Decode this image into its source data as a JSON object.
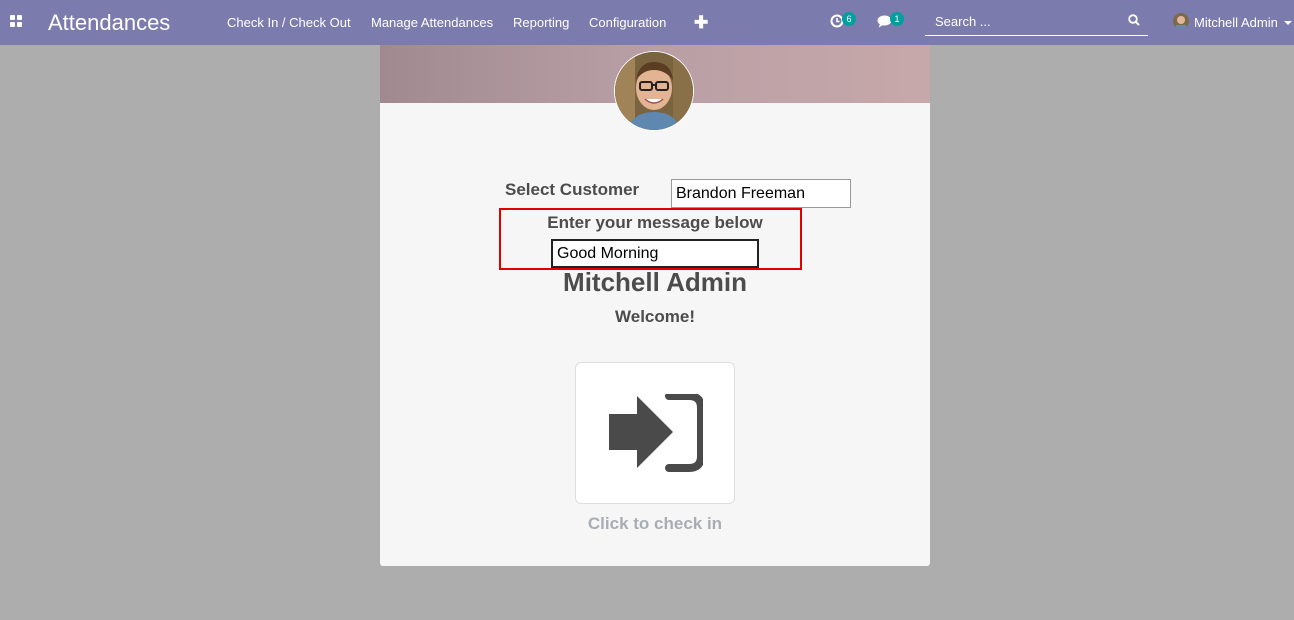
{
  "navbar": {
    "app_title": "Attendances",
    "menu": [
      "Check In / Check Out",
      "Manage Attendances",
      "Reporting",
      "Configuration"
    ],
    "plus_symbol": "✚",
    "activity_count": "6",
    "messages_count": "1",
    "search_placeholder": "Search ...",
    "user_name": "Mitchell Admin"
  },
  "form": {
    "customer_label": "Select Customer",
    "customer_value": "Brandon Freeman",
    "message_label": "Enter your message below",
    "message_value": "Good Morning"
  },
  "employee": {
    "name": "Mitchell Admin",
    "greeting": "Welcome!",
    "action_hint": "Click to check in"
  },
  "colors": {
    "navbar": "#7c7bad",
    "badge": "#00a09d",
    "highlight": "#e00000",
    "backdrop": "#adadad"
  },
  "icons": [
    "apps-grid-icon",
    "plus-icon",
    "activity-clock-icon",
    "chat-bubble-icon",
    "search-icon",
    "sign-in-icon"
  ]
}
